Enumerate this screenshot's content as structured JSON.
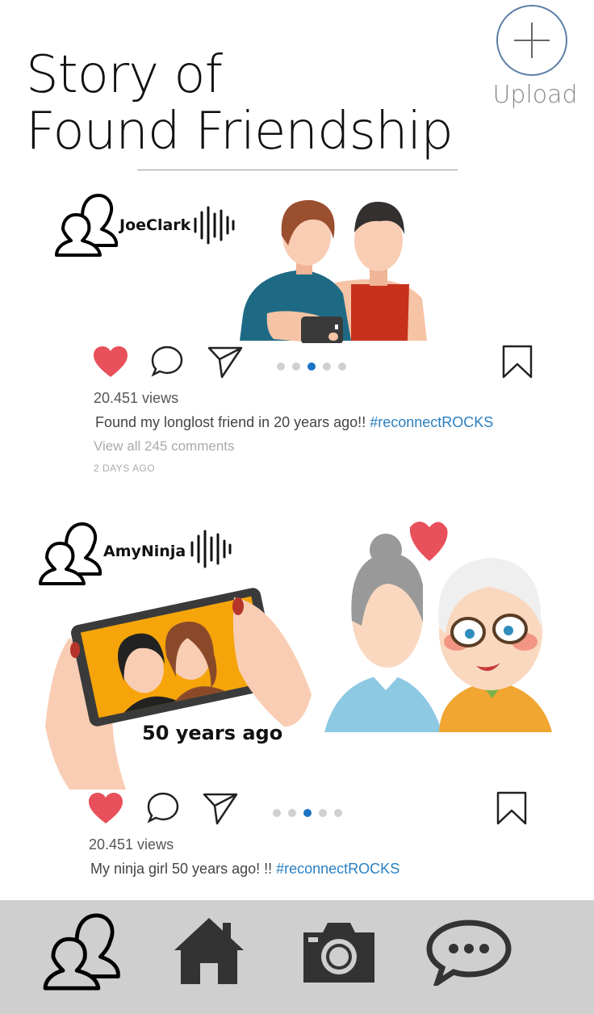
{
  "header": {
    "title_line1": "Story of",
    "title_line2": "Found Friendship",
    "upload_label": "Upload"
  },
  "posts": [
    {
      "username": "JoeClark",
      "views": "20.451 views",
      "caption": "Found my longlost friend in 20 years ago!!",
      "hashtag": "#reconnectROCKS",
      "comments": "View all 245 comments",
      "time_ago": "2 DAYS AGO",
      "carousel_active_index": 2,
      "carousel_count": 5
    },
    {
      "username": "AmyNinja",
      "views": "20.451 views",
      "caption": "My ninja girl 50 years ago!  !!",
      "hashtag": "#reconnectROCKS",
      "image_caption": "50 years ago",
      "carousel_active_index": 2,
      "carousel_count": 5
    }
  ],
  "bottom_nav": {
    "items": [
      "friends-icon",
      "home-icon",
      "camera-icon",
      "chat-icon"
    ]
  },
  "colors": {
    "like": "#e8505b",
    "link": "#2a7fc1",
    "carousel_active": "#1a73c5",
    "bottom_bar": "#cfcfcf"
  }
}
